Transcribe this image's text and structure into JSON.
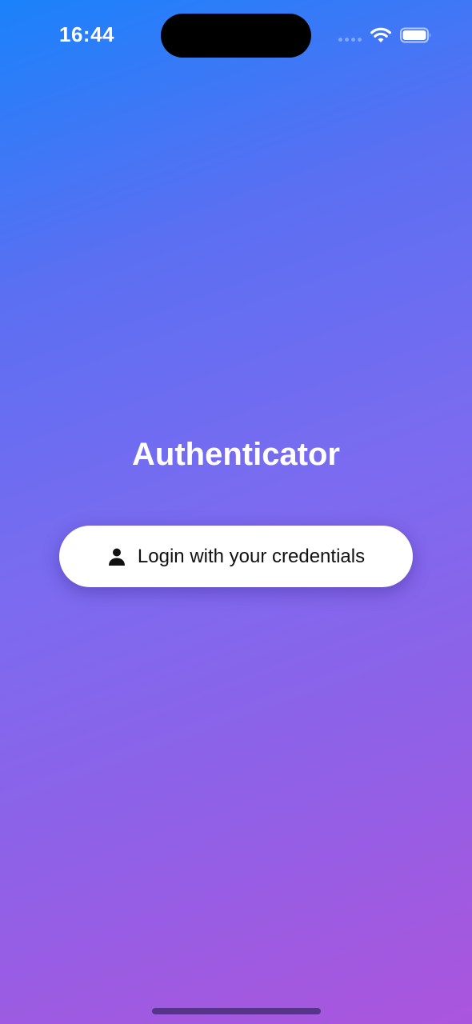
{
  "status_bar": {
    "time": "16:44",
    "icons": [
      "cellular-signal-icon",
      "wifi-icon",
      "battery-icon"
    ]
  },
  "main": {
    "title": "Authenticator",
    "login_button": {
      "label": "Login with your credentials",
      "icon": "person-icon"
    }
  },
  "colors": {
    "gradient_start": "#1a82fb",
    "gradient_end": "#ab55dd",
    "button_background": "#ffffff",
    "title_text": "#ffffff"
  }
}
